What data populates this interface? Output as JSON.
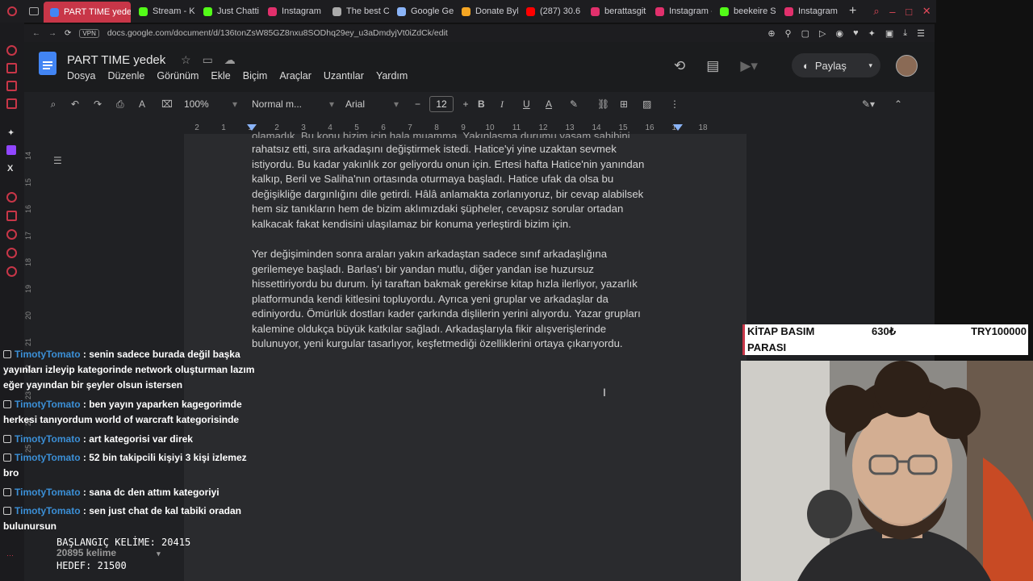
{
  "browser": {
    "tabs": [
      {
        "label": "PART TIME yedek - G",
        "color": "#4285f4",
        "active": true
      },
      {
        "label": "Stream - K",
        "color": "#53fc18"
      },
      {
        "label": "Just Chatti",
        "color": "#53fc18"
      },
      {
        "label": "Instagram",
        "color": "#e1306c"
      },
      {
        "label": "The best C",
        "color": "#aaaaaa"
      },
      {
        "label": "Google Ge",
        "color": "#8ab4f8"
      },
      {
        "label": "Donate Byh",
        "color": "#f5a623"
      },
      {
        "label": "(287) 30.6",
        "color": "#ff0000"
      },
      {
        "label": "berattasgit",
        "color": "#e1306c"
      },
      {
        "label": "Instagram -",
        "color": "#e1306c"
      },
      {
        "label": "beekeire S",
        "color": "#53fc18"
      },
      {
        "label": "Instagram",
        "color": "#e1306c"
      }
    ],
    "url": "docs.google.com/document/d/136tonZsW85GZ8nxu8SODhq29ey_u3aDmdyjVt0iZdCk/edit",
    "vpn_label": "VPN"
  },
  "docs": {
    "title": "PART TIME  yedek",
    "menu": [
      "Dosya",
      "Düzenle",
      "Görünüm",
      "Ekle",
      "Biçim",
      "Araçlar",
      "Uzantılar",
      "Yardım"
    ],
    "share_label": "Paylaş",
    "zoom": "100%",
    "style": "Normal m...",
    "font": "Arial",
    "font_size": "12",
    "ruler_ticks": [
      "2",
      "1",
      "1",
      "2",
      "3",
      "4",
      "5",
      "6",
      "7",
      "8",
      "9",
      "10",
      "11",
      "12",
      "13",
      "14",
      "15",
      "16",
      "17",
      "18"
    ],
    "side_ruler": [
      "14",
      "15",
      "16",
      "17",
      "18",
      "19",
      "20",
      "21",
      "22",
      "23",
      "24",
      "25"
    ],
    "paragraph1_top": "olamadık. Bu konu bizim için hala muamma. Yakınlaşma durumu yaşam sahibini",
    "paragraph1": [
      "rahatsız etti, sıra arkadaşını değiştirmek istedi. Hatice'yi yine uzaktan sevmek",
      "istiyordu. Bu kadar yakınlık zor geliyordu onun için. Ertesi hafta Hatice'nin yanından",
      "kalkıp, Beril ve Saliha'nın ortasında oturmaya başladı. Hatice ufak da olsa bu",
      "değişikliğe dargınlığını dile getirdi. Hâlâ anlamakta zorlanıyoruz, bir cevap alabilsek",
      "hem siz tanıkların hem de bizim aklımızdaki şüpheler, cevapsız sorular ortadan",
      "kalkacak fakat kendisini ulaşılamaz bir konuma yerleştirdi bizim için."
    ],
    "paragraph2": [
      "Yer değişiminden sonra araları yakın arkadaştan sadece sınıf arkadaşlığına",
      "gerilemeye başladı. Barlas'ı bir yandan mutlu, diğer yandan ise huzursuz",
      "hissettiriyordu bu durum. İyi taraftan bakmak gerekirse kitap hızla ilerliyor, yazarlık",
      "platformunda kendi kitlesini topluyordu. Ayrıca yeni gruplar ve arkadaşlar da",
      "ediniyordu. Ömürlük dostları kader çarkında dişlilerin yerini alıyordu. Yazar grupları",
      "kalemine oldukça büyük katkılar sağladı. Arkadaşlarıyla fikir alışverişlerinde",
      "bulunuyor, yeni kurgular tasarlıyor, keşfetmediği özelliklerini ortaya çıkarıyordu."
    ]
  },
  "chat": [
    {
      "user": "TimotyTomato",
      "text": ": senin sadece burada değil başka yayınları izleyip kategorinde network oluşturman lazım eğer yayından bir şeyler olsun istersen"
    },
    {
      "user": "TimotyTomato",
      "text": ": ben yayın yaparken kagegorimde herkesi tanıyordum world of warcraft kategorisinde"
    },
    {
      "user": "TimotyTomato",
      "text": ": art kategorisi var direk"
    },
    {
      "user": "TimotyTomato",
      "text": ": 52 bin takipcili kişiyi 3 kişi izlemez bro"
    },
    {
      "user": "TimotyTomato",
      "text": ": sana dc den attım kategoriyi"
    },
    {
      "user": "TimotyTomato",
      "text": ": sen just chat de kal tabiki oradan bulunursun"
    }
  ],
  "counter": {
    "start": "BAŞLANGIÇ KELİME: 20415",
    "words": "20895 kelime",
    "target": "HEDEF: 21500"
  },
  "banner": {
    "label_line1": "KİTAP BASIM",
    "label_line2": "PARASI",
    "current": "630₺",
    "goal": "TRY100000"
  }
}
